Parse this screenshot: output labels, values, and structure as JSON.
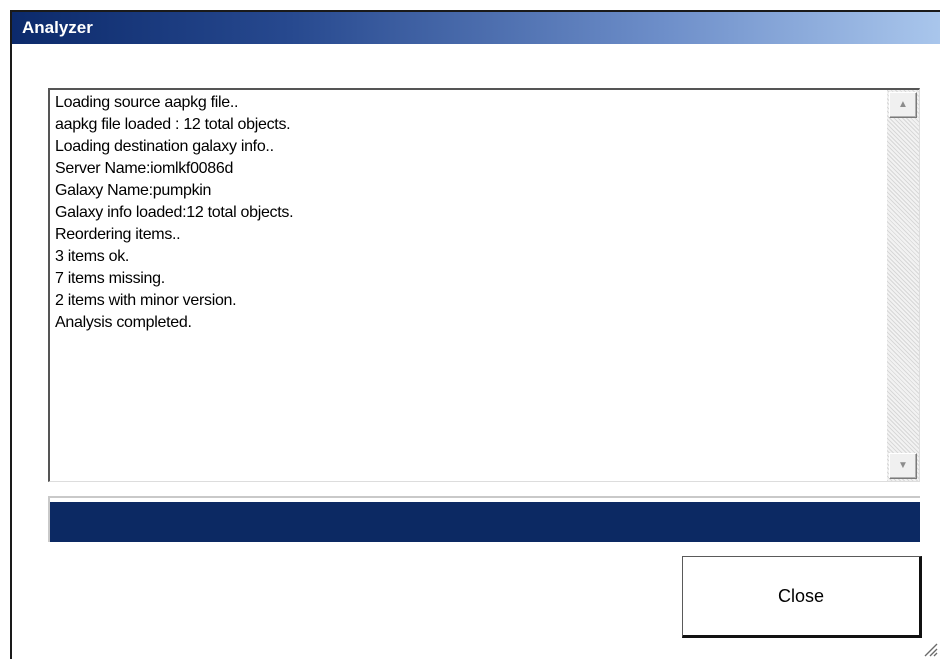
{
  "window": {
    "title": "Analyzer"
  },
  "log": {
    "lines": [
      "Loading source aapkg file..",
      "aapkg file loaded : 12 total objects.",
      "Loading destination galaxy info..",
      "Server Name:iomlkf0086d",
      "Galaxy Name:pumpkin",
      "Galaxy info loaded:12 total objects.",
      "Reordering items..",
      "3 items ok.",
      "7 items missing.",
      "2 items with minor version.",
      "Analysis completed."
    ]
  },
  "scrollbar": {
    "up_icon": "up-arrow-icon",
    "down_icon": "down-arrow-icon"
  },
  "progress": {
    "fraction": 1.0,
    "color": "#0c2963"
  },
  "buttons": {
    "close_label": "Close"
  },
  "colors": {
    "titlebar_start": "#0c2a6b",
    "titlebar_end": "#a9c6ec"
  }
}
